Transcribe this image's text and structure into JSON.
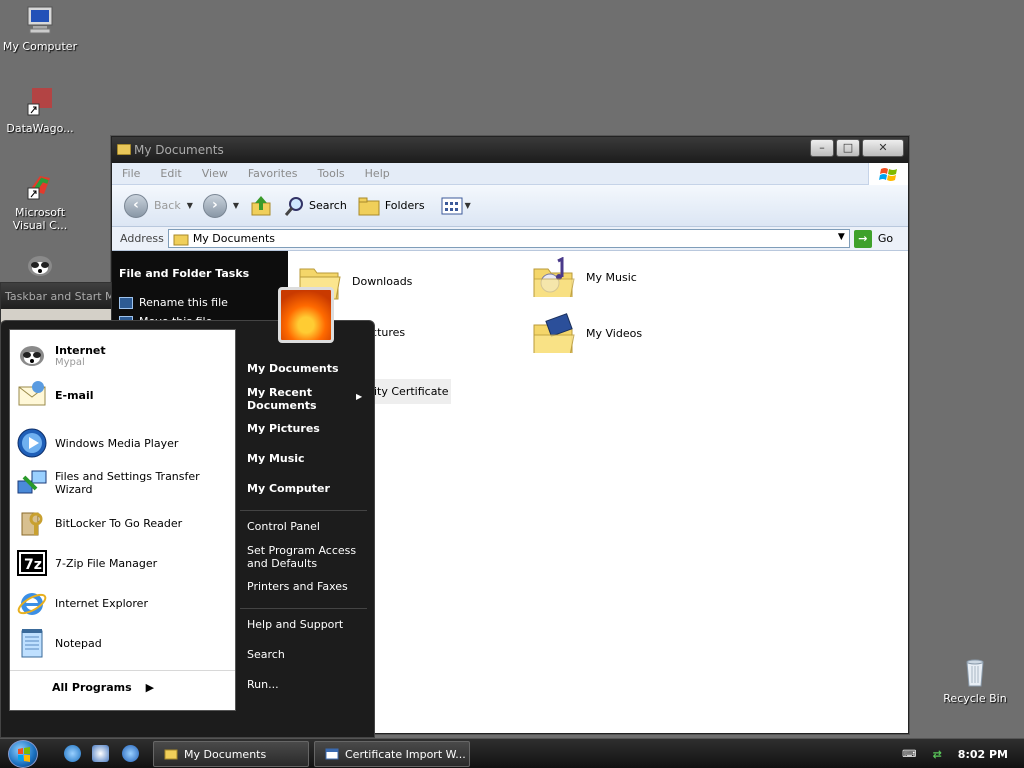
{
  "desktop": {
    "icons": [
      {
        "label": "My Computer",
        "icon": "computer-icon"
      },
      {
        "label": "DataWago...",
        "icon": "datawagon-icon"
      },
      {
        "label": "Microsoft Visual C...",
        "icon": "visual-studio-icon"
      },
      {
        "label": "Recycle Bin",
        "icon": "recycle-bin-icon"
      }
    ]
  },
  "explorer": {
    "title": "My Documents",
    "menu": [
      "File",
      "Edit",
      "View",
      "Favorites",
      "Tools",
      "Help"
    ],
    "toolbar": {
      "back": "Back",
      "search": "Search",
      "folders": "Folders"
    },
    "address": {
      "label": "Address",
      "value": "My Documents",
      "go": "Go"
    },
    "tasks": {
      "heading": "File and Folder Tasks",
      "rename": "Rename this file",
      "move": "Move this file"
    },
    "files": [
      {
        "name": "Downloads",
        "icon": "folder-icon"
      },
      {
        "name": "My Music",
        "icon": "music-folder-icon"
      },
      {
        "name": "My Pictures",
        "icon": "pictures-folder-icon"
      },
      {
        "name": "My Videos",
        "icon": "videos-folder-icon"
      },
      {
        "name": "Security Certificate",
        "icon": "certificate-icon"
      }
    ],
    "visible_file_labels": {
      "pictures": "ictures",
      "certificate": "ity Certificate"
    }
  },
  "background_window": {
    "title": "Taskbar and Start M"
  },
  "start_menu": {
    "pinned": [
      {
        "label": "Internet",
        "sub": "Mypal"
      },
      {
        "label": "E-mail"
      }
    ],
    "recent": [
      "Windows Media Player",
      "Files and Settings Transfer Wizard",
      "BitLocker To Go Reader",
      "7-Zip File Manager",
      "Internet Explorer",
      "Notepad"
    ],
    "all_programs": "All Programs",
    "right": [
      "My Documents",
      "My Recent Documents",
      "My Pictures",
      "My Music",
      "My Computer",
      "Control Panel",
      "Set Program Access and Defaults",
      "Printers and Faxes",
      "Help and Support",
      "Search",
      "Run..."
    ]
  },
  "taskbar": {
    "buttons": [
      "My Documents",
      "Certificate Import W..."
    ],
    "clock": "8:02 PM"
  }
}
